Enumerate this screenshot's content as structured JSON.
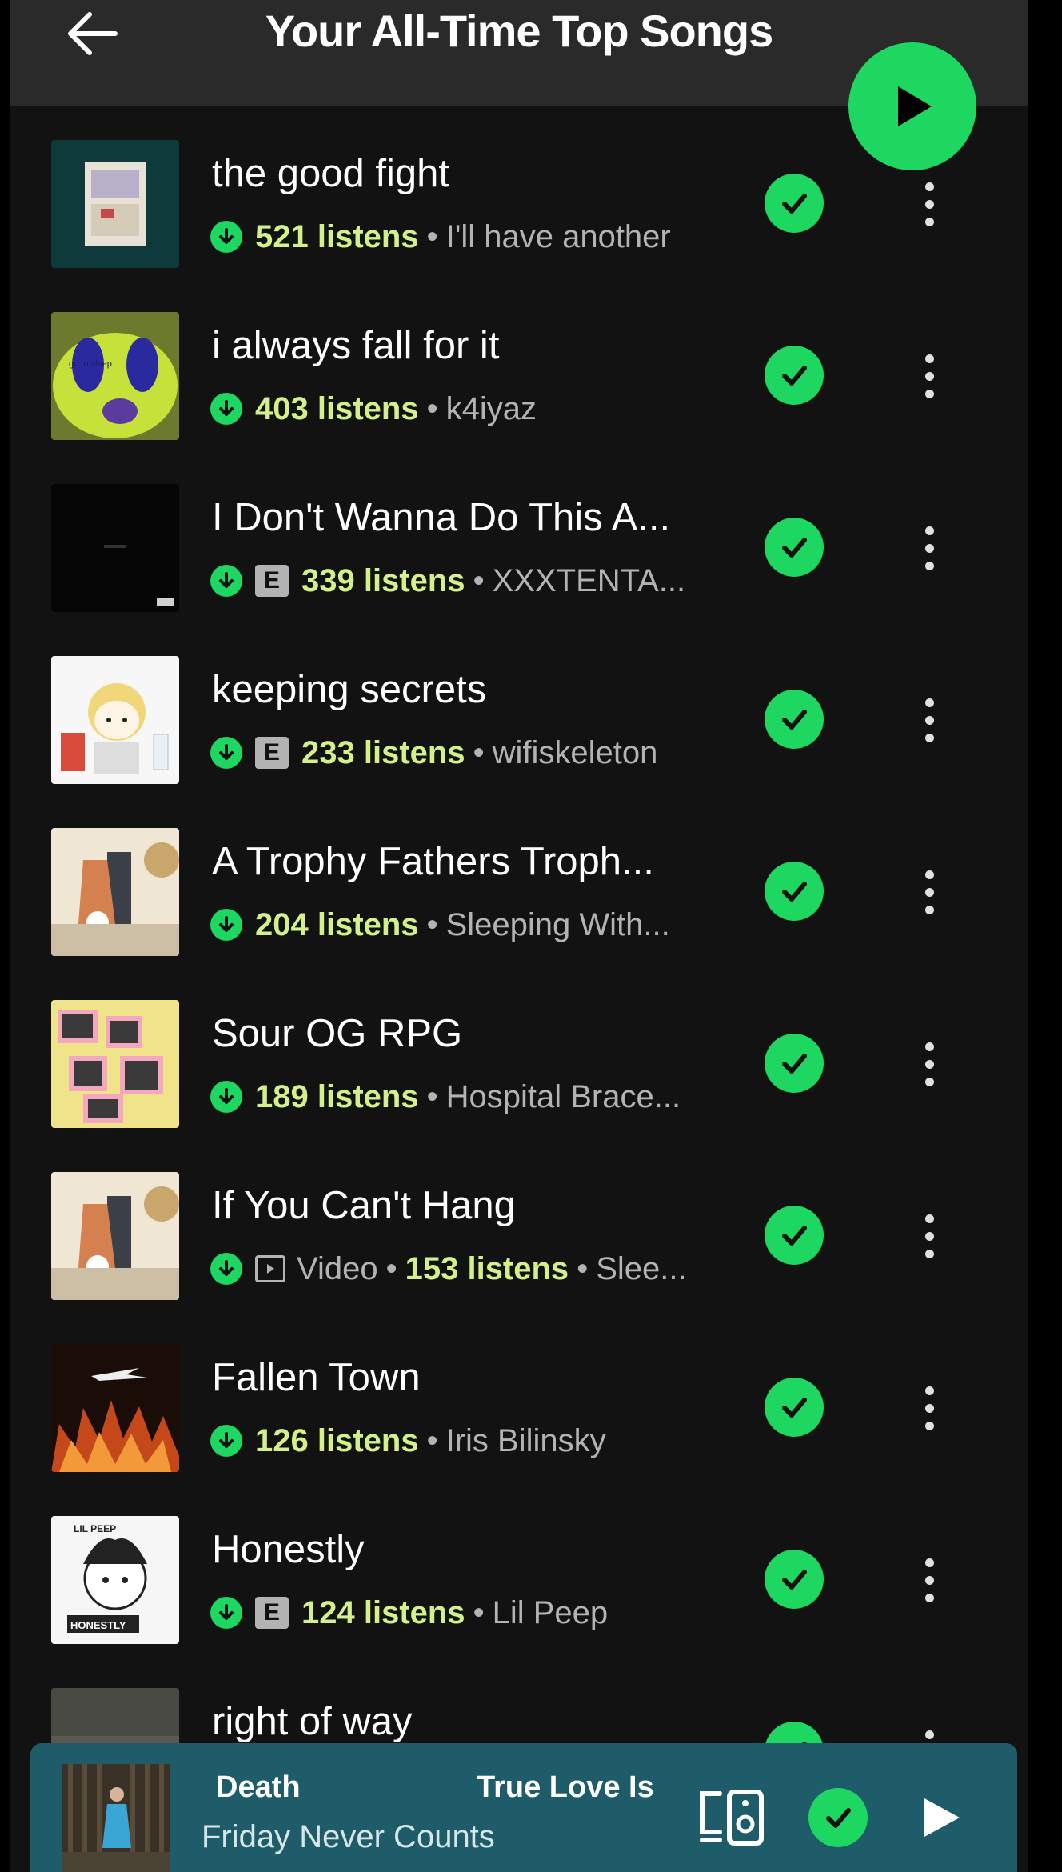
{
  "header": {
    "title": "Your All-Time Top Songs",
    "back_icon": "arrow-left-icon",
    "play_icon": "play-icon"
  },
  "colors": {
    "accent": "#1ed760",
    "listens": "#d3f08a",
    "background": "#121212",
    "header": "#2a2a2a",
    "mini_player": "#1e5c6a"
  },
  "songs": [
    {
      "title": "the good fight",
      "listens": "521 listens",
      "artist": "I'll have another",
      "explicit": false,
      "video": false
    },
    {
      "title": "i always fall for it",
      "listens": "403 listens",
      "artist": "k4iyaz",
      "explicit": false,
      "video": false
    },
    {
      "title": "I Don't Wanna Do This A...",
      "listens": "339 listens",
      "artist": "XXXTENTA...",
      "explicit": true,
      "video": false
    },
    {
      "title": "keeping secrets",
      "listens": "233 listens",
      "artist": "wifiskeleton",
      "explicit": true,
      "video": false
    },
    {
      "title": "A Trophy Fathers Troph...",
      "listens": "204 listens",
      "artist": "Sleeping With...",
      "explicit": false,
      "video": false
    },
    {
      "title": "Sour OG RPG",
      "listens": "189 listens",
      "artist": "Hospital Brace...",
      "explicit": false,
      "video": false
    },
    {
      "title": "If You Can't Hang",
      "listens": "153 listens",
      "artist": "Slee...",
      "explicit": false,
      "video": true,
      "video_label": "Video"
    },
    {
      "title": "Fallen Town",
      "listens": "126 listens",
      "artist": "Iris Bilinsky",
      "explicit": false,
      "video": false
    },
    {
      "title": "Honestly",
      "listens": "124 listens",
      "artist": "Lil Peep",
      "explicit": true,
      "video": false
    },
    {
      "title": "right of way",
      "listens": "",
      "artist": "",
      "explicit": false,
      "video": false
    }
  ],
  "explicit_label": "E",
  "separator": "•",
  "album_art_text": {
    "i_always_fall_for_it": "go to sleep",
    "honestly_top": "LIL PEEP",
    "honestly_bottom": "HONESTLY"
  },
  "mini_player": {
    "track_part_1": "Death",
    "track_part_2": "True Love Is",
    "artist": "Friday Never Counts",
    "device_icon": "connect-device-icon",
    "saved_icon": "check-icon",
    "play_icon": "play-icon"
  }
}
